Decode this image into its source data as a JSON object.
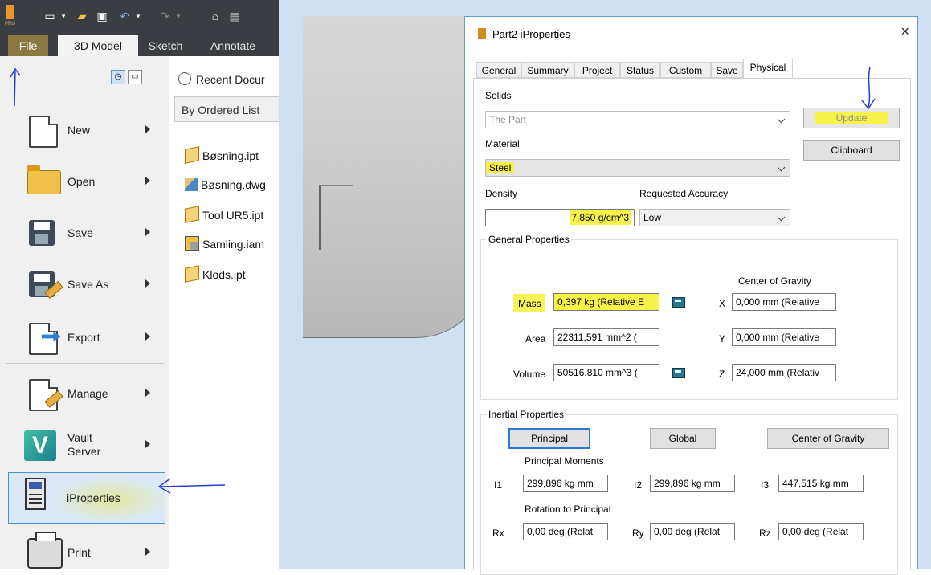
{
  "left_panel": {
    "tabs": {
      "file": "File",
      "model": "3D Model",
      "sketch": "Sketch",
      "annotate": "Annotate"
    },
    "app_badge": "PRO",
    "menu": [
      {
        "id": "new",
        "label": "New"
      },
      {
        "id": "open",
        "label": "Open"
      },
      {
        "id": "save",
        "label": "Save"
      },
      {
        "id": "save_as",
        "label": "Save As"
      },
      {
        "id": "export",
        "label": "Export"
      },
      {
        "id": "manage",
        "label": "Manage"
      },
      {
        "id": "vault",
        "label": "Vault Server",
        "line1": "Vault",
        "line2": "Server"
      },
      {
        "id": "iproperties",
        "label": "iProperties"
      },
      {
        "id": "print",
        "label": "Print"
      }
    ],
    "recent": {
      "header": "Recent Documents",
      "header_visible": "Recent Docur",
      "sort": "By Ordered List",
      "files": [
        "Bøsning.ipt",
        "Bøsning.dwg",
        "Tool UR5.ipt",
        "Samling.iam",
        "Klods.ipt"
      ]
    }
  },
  "dialog": {
    "title": "Part2 iProperties",
    "close": "×",
    "tabs": [
      "General",
      "Summary",
      "Project",
      "Status",
      "Custom",
      "Save",
      "Physical"
    ],
    "active_tab": "Physical",
    "solids_label": "Solids",
    "solids_value": "The Part",
    "material_label": "Material",
    "material_value": "Steel",
    "density_label": "Density",
    "density_value": "7,850 g/cm^3",
    "accuracy_label": "Requested Accuracy",
    "accuracy_value": "Low",
    "update_button": "Update",
    "clipboard_button": "Clipboard",
    "general_group": "General Properties",
    "cog_header": "Center of Gravity",
    "mass_label": "Mass",
    "mass_value": "0,397 kg (Relative E",
    "area_label": "Area",
    "area_value": "22311,591 mm^2 (",
    "volume_label": "Volume",
    "volume_value": "50516,810 mm^3 (",
    "x_label": "X",
    "x_value": "0,000 mm (Relative",
    "y_label": "Y",
    "y_value": "0,000 mm (Relative",
    "z_label": "Z",
    "z_value": "24,000 mm (Relativ",
    "inertial_group": "Inertial Properties",
    "principal_button": "Principal",
    "global_button": "Global",
    "cog_button": "Center of Gravity",
    "principal_moments_label": "Principal Moments",
    "i1_label": "I1",
    "i1_value": "299,896 kg mm",
    "i2_label": "I2",
    "i2_value": "299,896 kg mm",
    "i3_label": "I3",
    "i3_value": "447,515 kg mm",
    "rotation_label": "Rotation to Principal",
    "rx_label": "Rx",
    "rx_value": "0,00 deg (Relat",
    "ry_label": "Ry",
    "ry_value": "0,00 deg (Relat",
    "rz_label": "Rz",
    "rz_value": "0,00 deg (Relat"
  },
  "colors": {
    "highlight": "#f7f247",
    "annotation_arrow": "#2a3fcf",
    "ribbon": "#3a3d42",
    "selection": "#dbe8f6"
  }
}
